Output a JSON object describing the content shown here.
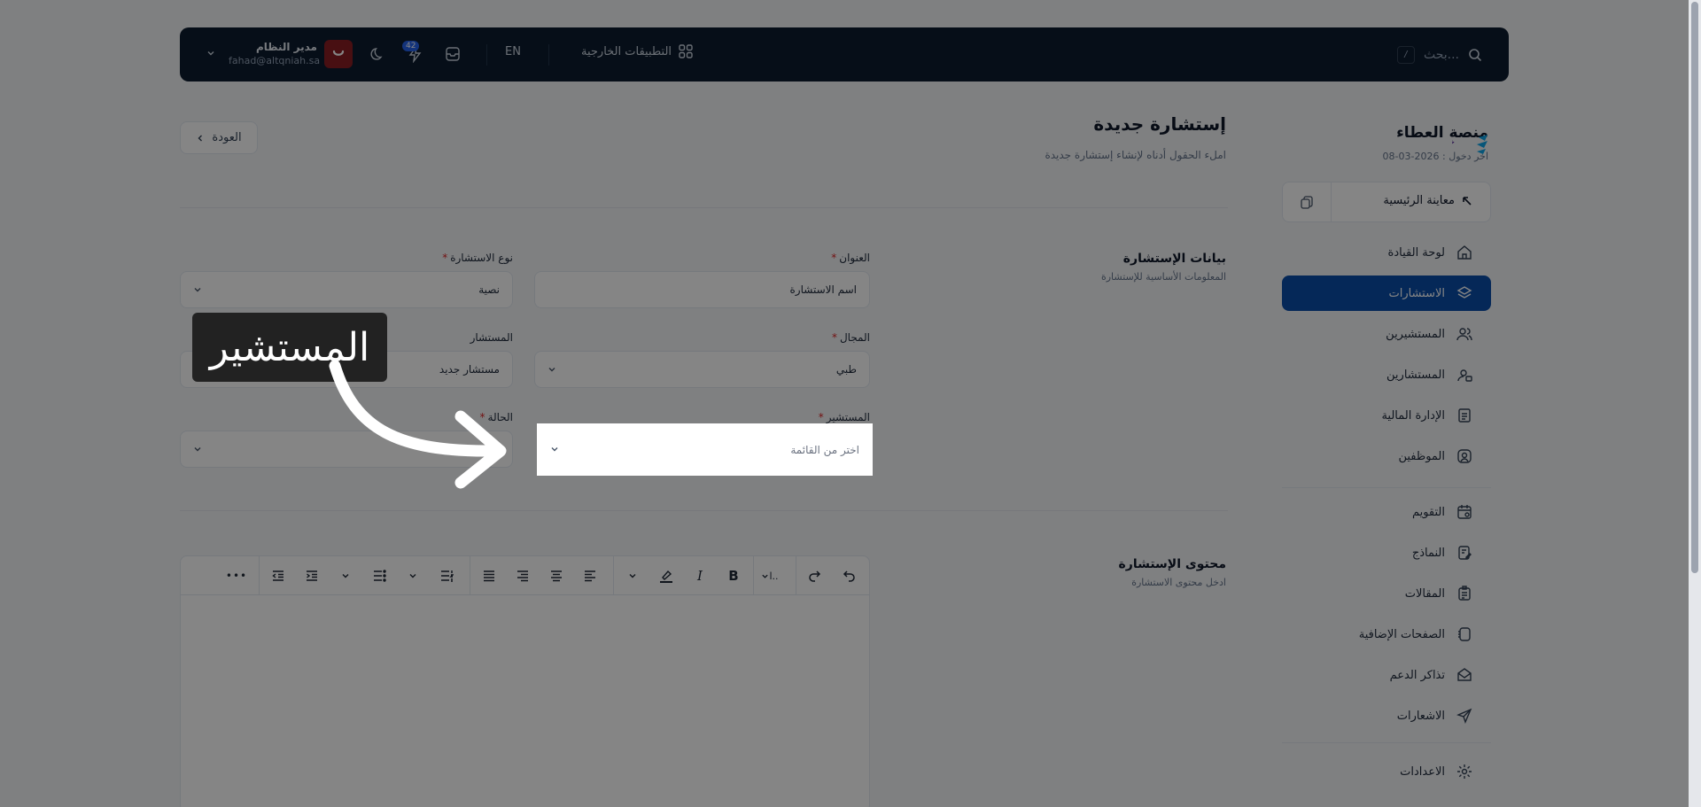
{
  "header": {
    "search_placeholder": "بحث...",
    "search_shortcut": "/",
    "external_apps": "التطبيقات الخارجية",
    "language": "EN",
    "notifications_count": "42",
    "user_name": "مدير النظام",
    "user_email": "fahad@altqniah.sa"
  },
  "sidebar": {
    "brand_name": "منصة العطاء",
    "last_login": "اخر دخول : 2026-03-08",
    "preview_label": "معاينة الرئيسية",
    "items": [
      {
        "label": "لوحة القيادة",
        "icon": "home-icon"
      },
      {
        "label": "الاستشارات",
        "icon": "layers-icon",
        "active": true
      },
      {
        "label": "المستشيرين",
        "icon": "users-icon"
      },
      {
        "label": "المستشارين",
        "icon": "user-card-icon"
      },
      {
        "label": "الإدارة المالية",
        "icon": "document-icon"
      },
      {
        "label": "الموظفين",
        "icon": "user-square-icon"
      },
      {
        "label": "التقويم",
        "icon": "calendar-icon"
      },
      {
        "label": "النماذج",
        "icon": "form-icon"
      },
      {
        "label": "المقالات",
        "icon": "article-icon"
      },
      {
        "label": "الصفحات الإضافية",
        "icon": "pages-icon"
      },
      {
        "label": "تذاكر الدعم",
        "icon": "ticket-icon"
      },
      {
        "label": "الاشعارات",
        "icon": "send-icon"
      },
      {
        "label": "الاعدادات",
        "icon": "gear-icon"
      }
    ]
  },
  "page": {
    "title": "إستشارة جديدة",
    "subtitle": "املء الحقول أدناه لإنشاء إستشارة جديدة",
    "back_label": "العودة"
  },
  "section_info": {
    "title": "بيانات الإستشارة",
    "subtitle": "المعلومات الأساسية للإستشارة"
  },
  "fields": {
    "title_label": "العنوان",
    "title_value": "اسم الاستشارة",
    "type_label": "نوع الاستشارة",
    "type_value": "نصية",
    "domain_label": "المجال",
    "domain_value": "طبي",
    "consultant_label": "المستشار",
    "consultant_value": "مستشار جديد",
    "client_label": "المستشير",
    "client_placeholder": "اختر من القائمة",
    "status_label": "الحالة",
    "required_mark": "*"
  },
  "section_content": {
    "title": "محتوى الإستشارة",
    "subtitle": "ادخل محتوى الاستشارة"
  },
  "editor": {
    "paragraph_label": "ا..",
    "bold": "B",
    "italic": "I",
    "more": "•••"
  },
  "overlay": {
    "tooltip_text": "المستشير"
  },
  "colors": {
    "topbar": "#0d1b2e",
    "accent": "#0b4eaa",
    "danger": "#dc2626"
  }
}
